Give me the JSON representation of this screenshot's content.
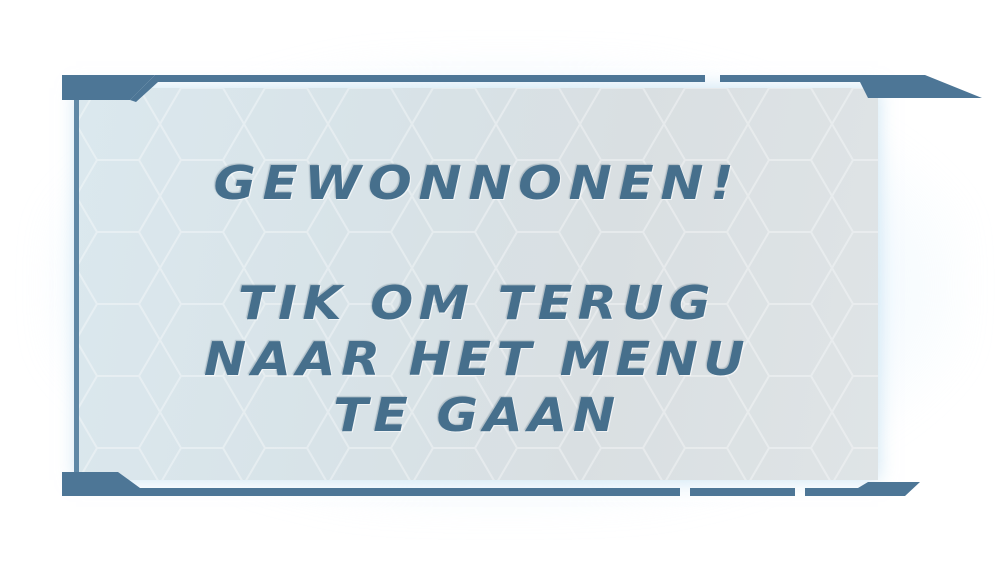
{
  "dialog": {
    "title": "GEWONNONEN!",
    "instruction_lines": [
      "TIK OM TERUG",
      "NAAR HET MENU",
      "TE GAAN"
    ]
  },
  "colors": {
    "text": "#466f8c",
    "frame": "#4d7696",
    "panel": "#d8e3e8",
    "glow": "#bfe2f5"
  }
}
